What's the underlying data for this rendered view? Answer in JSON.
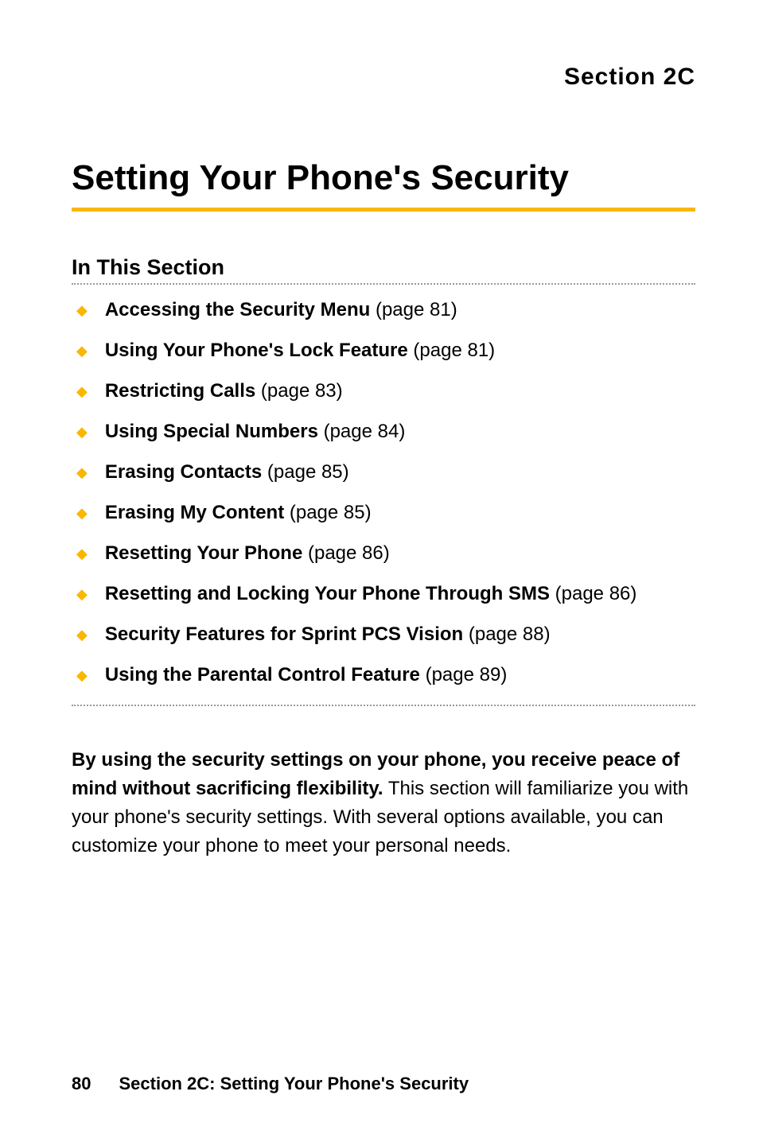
{
  "section_label": "Section 2C",
  "main_title": "Setting Your Phone's Security",
  "subsection_title": "In This Section",
  "toc_items": [
    {
      "title": "Accessing the Security Menu",
      "page": " (page 81)"
    },
    {
      "title": "Using Your Phone's Lock Feature",
      "page": " (page 81)"
    },
    {
      "title": "Restricting Calls",
      "page": " (page 83)"
    },
    {
      "title": "Using Special Numbers",
      "page": " (page 84)"
    },
    {
      "title": "Erasing Contacts",
      "page": " (page 85)"
    },
    {
      "title": "Erasing My Content",
      "page": " (page 85)"
    },
    {
      "title": "Resetting Your Phone",
      "page": " (page 86)"
    },
    {
      "title": "Resetting and Locking Your Phone Through SMS",
      "page": " (page 86)"
    },
    {
      "title": "Security Features for Sprint PCS Vision",
      "page": " (page 88)"
    },
    {
      "title": "Using the Parental Control Feature",
      "page": " (page 89)"
    }
  ],
  "body": {
    "bold": "By using the security settings on your phone, you receive peace of mind without sacrificing flexibility.",
    "rest": " This section will familiarize you with your phone's security settings. With several options available, you can customize your phone to meet your personal needs."
  },
  "footer": {
    "page_number": "80",
    "text": "Section 2C: Setting Your Phone's Security"
  }
}
